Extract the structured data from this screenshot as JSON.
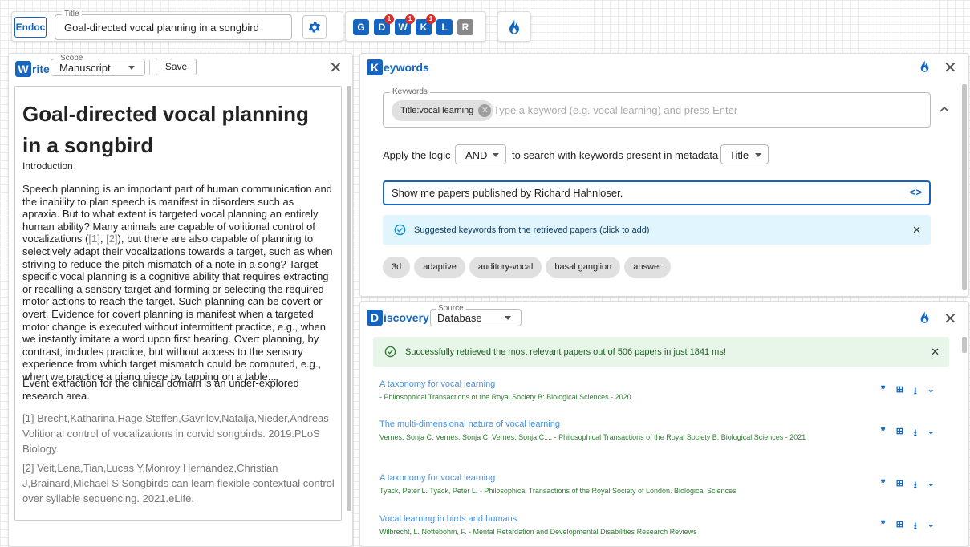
{
  "header": {
    "brand": "Endoc",
    "title_legend": "Title",
    "title_value": "Goal-directed vocal planning in a songbird",
    "tools": [
      {
        "letter": "G",
        "badge": ""
      },
      {
        "letter": "D",
        "badge": "1"
      },
      {
        "letter": "W",
        "badge": "1"
      },
      {
        "letter": "K",
        "badge": "1"
      },
      {
        "letter": "L",
        "badge": ""
      },
      {
        "letter": "R",
        "badge": ""
      }
    ]
  },
  "write": {
    "logo_letter": "W",
    "title_rest": "rite",
    "scope_legend": "Scope",
    "scope_value": "Manuscript",
    "save_label": "Save",
    "close_symbol": "✕",
    "doc_title": "Goal-directed vocal planning in a songbird",
    "section_heading": "Introduction",
    "para1_before": "Speech planning is an important part of human communication and the inability to plan speech is manifest in disorders such as apraxia. But to what extent is targeted vocal planning an entirely human ability? Many animals are capable of volitional control of vocalizations (",
    "cite1": "[1]",
    "cite_sep": ", ",
    "cite2": "[2]",
    "para1_after": "), but there are also capable of planning to selectively adapt their vocalizations towards a target, such as when striving to reduce the pitch mismatch of a note in a song? Target-specific vocal planning is a cognitive ability that requires extracting or recalling a sensory target and forming or selecting the required motor actions to reach the target. Such planning can be covert or overt. Evidence for covert planning is manifest when a targeted motor change is executed without intermittent practice, e.g., when we instantly imitate a word upon first hearing. Overt planning, by contrast, includes practice, but without access to the sensory experience from which target mismatch could be computed, e.g., when we practice a piano piece by tapping on a table...",
    "para2": "Event extraction for the clinical domain is an under-explored research area.",
    "ref1": "[1] Brecht,Katharina,Hage,Steffen,Gavrilov,Natalja,Nieder,Andreas Volitional control of vocalizations in corvid songbirds. 2019.PLoS Biology.",
    "ref2": "[2] Veit,Lena,Tian,Lucas Y,Monroy Hernandez,Christian J,Brainard,Michael S Songbirds can learn flexible contextual control over syllable sequencing. 2021.eLife."
  },
  "keywords": {
    "logo_letter": "K",
    "title_rest": "eywords",
    "close_symbol": "✕",
    "field_legend": "Keywords",
    "chip_label": "Title:vocal learning",
    "placeholder": "Type a keyword (e.g. vocal learning) and press Enter",
    "logic_prefix": "Apply the logic",
    "logic_value": "AND",
    "logic_suffix": "to search with keywords present in metadata",
    "metadata_value": "Title",
    "query_value": "Show me papers published by Richard Hahnloser.",
    "code_symbol": "<>",
    "suggest_text": "Suggested keywords from the retrieved papers (click to add)",
    "suggestions": [
      "3d",
      "adaptive",
      "auditory-vocal",
      "basal ganglion",
      "answer"
    ]
  },
  "discovery": {
    "logo_letter": "D",
    "title_rest": "iscovery",
    "close_symbol": "✕",
    "source_legend": "Source",
    "source_value": "Database",
    "success_text": "Successfully retrieved the most relevant papers out of 506 papers in just 1841 ms!",
    "results": [
      {
        "title": "A taxonomy for vocal learning",
        "meta": "- Philosophical Transactions of the Royal Society B: Biological Sciences - 2020"
      },
      {
        "title": "The multi-dimensional nature of vocal learning",
        "meta": "Vernes, Sonja C. Vernes, Sonja C. Vernes, Sonja C.... - Philosophical Transactions of the Royal Society B: Biological Sciences - 2021"
      },
      {
        "title": "A taxonomy for vocal learning",
        "meta": "Tyack, Peter L. Tyack, Peter L. - Philosophical Transactions of the Royal Society of London. Biological Sciences"
      },
      {
        "title": "Vocal learning in birds and humans.",
        "meta": "Wilbrecht, L. Nottebohm, F. - Mental Retardation and Developmental Disabilities Research Reviews"
      }
    ]
  },
  "colors": {
    "accent": "#1565c0",
    "fire": "#1565c0",
    "link": "#4a90d9",
    "meta_green": "#2e7d32",
    "success_bg": "#e8f5e9",
    "info_bg": "#e1f5fe",
    "badge_red": "#d32f2f"
  },
  "icons": [
    "gear-icon",
    "fire-icon",
    "close-icon",
    "chevron-down-icon",
    "chevron-up-icon",
    "check-circle-icon",
    "cancel-circle-icon",
    "code-icon",
    "quote-icon",
    "add-box-icon",
    "download-icon"
  ]
}
